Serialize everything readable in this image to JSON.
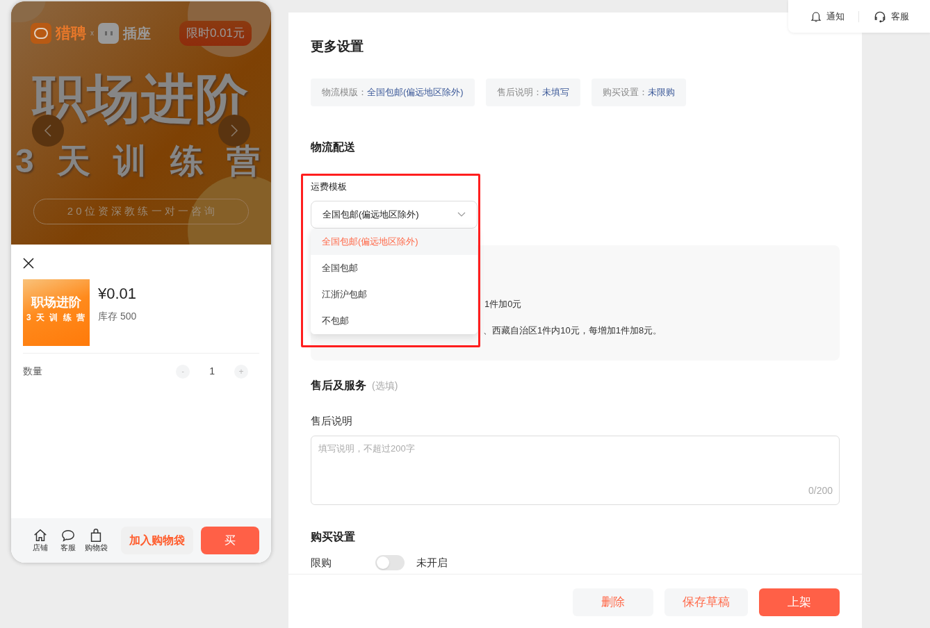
{
  "banner": {
    "brand_primary": "猎聘",
    "brand_separator": "x",
    "brand_secondary": "插座",
    "promo": "限时0.01元",
    "title": "职场进阶",
    "subtitle": "3 天 训 练 营",
    "tagline": "2 0 位 资 深 教 练 一 对 一 咨 询"
  },
  "sheet": {
    "thumb": {
      "title": "职场进阶",
      "subtitle": "3 天 训 练 营"
    },
    "price": "¥0.01",
    "stock": "库存 500",
    "quantity_label": "数量",
    "minus": "-",
    "quantity": "1",
    "plus": "+"
  },
  "bottom_bar": {
    "icons": [
      {
        "kind": "home",
        "label": "店铺"
      },
      {
        "kind": "chat",
        "label": "客服"
      },
      {
        "kind": "bag",
        "label": "购物袋"
      }
    ],
    "cart_button": "加入购物袋",
    "buy_button": "买"
  },
  "top_toolbar": [
    {
      "kind": "bell",
      "label": "通知"
    },
    {
      "kind": "headset",
      "label": "客服"
    }
  ],
  "settings": {
    "title": "更多设置",
    "chips": [
      {
        "label": "物流模版：",
        "value": "全国包邮(偏远地区除外)"
      },
      {
        "label": "售后说明：",
        "value": "未填写"
      },
      {
        "label": "购买设置：",
        "value": "未限购"
      }
    ]
  },
  "shipping": {
    "title": "物流配送",
    "field_label": "运费模板",
    "value": "全国包邮(偏远地区除外)",
    "options": [
      {
        "label": "全国包邮(偏远地区除外)",
        "selected": true
      },
      {
        "label": "全国包邮",
        "selected": false
      },
      {
        "label": "江浙沪包邮",
        "selected": false
      },
      {
        "label": "不包邮",
        "selected": false
      }
    ],
    "info_fragments": [
      "1件加0元",
      "、西藏自治区1件内10元，每增加1件加8元。"
    ]
  },
  "after_sales": {
    "title": "售后及服务",
    "optional": "(选填)",
    "field_label": "售后说明",
    "placeholder": "填写说明，不超过200字",
    "counter": "0/200"
  },
  "purchase": {
    "title": "购买设置",
    "limit_label": "限购",
    "limit_on": false,
    "limit_status": "未开启"
  },
  "footer_buttons": [
    {
      "kind": "secondary",
      "label": "删除"
    },
    {
      "kind": "secondary",
      "label": "保存草稿"
    },
    {
      "kind": "primary",
      "label": "上架"
    }
  ]
}
